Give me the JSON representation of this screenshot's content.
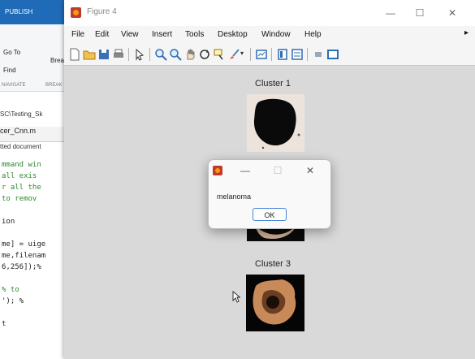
{
  "background_app": {
    "ribbon_tab": "PUBLISH",
    "toolbar": {
      "go_to": "Go To",
      "find": "Find",
      "breakpoints": "Brea",
      "navigate": "NAVIGATE",
      "edit": "BREAK"
    },
    "path": "SC\\Testing_Sk",
    "editor_tab": "cer_Cnn.m",
    "doc_notice": "tted document",
    "code_lines": [
      {
        "text": "mmand win",
        "color": "green"
      },
      {
        "text": " all exis",
        "color": "green"
      },
      {
        "text": "r all the",
        "color": "green"
      },
      {
        "text": " to remov",
        "color": "green"
      },
      {
        "text": "",
        "color": "black"
      },
      {
        "text": "ion",
        "color": "black"
      },
      {
        "text": "",
        "color": "black"
      },
      {
        "text": "me] = uige",
        "color": "black"
      },
      {
        "text": "me,filenam",
        "color": "black"
      },
      {
        "text": "6,256]);%",
        "color": "black"
      },
      {
        "text": "",
        "color": "black"
      },
      {
        "text": "    % to",
        "color": "green"
      },
      {
        "text": "');   %",
        "color": "black"
      },
      {
        "text": "",
        "color": "black"
      },
      {
        "text": "t",
        "color": "black"
      }
    ]
  },
  "figure_window": {
    "title": "Figure 4",
    "controls": {
      "minimize": "—",
      "maximize": "☐",
      "close": "✕"
    },
    "menu": [
      "File",
      "Edit",
      "View",
      "Insert",
      "Tools",
      "Desktop",
      "Window",
      "Help"
    ],
    "menu_more": "▸",
    "toolbar_icons": [
      "new-figure-icon",
      "open-file-icon",
      "save-icon",
      "print-icon",
      "pointer-icon",
      "zoom-in-icon",
      "zoom-out-icon",
      "pan-icon",
      "rotate-icon",
      "data-cursor-icon",
      "brush-icon",
      "link-icon",
      "colorbar-icon",
      "legend-icon",
      "hide-tools-icon",
      "dock-icon"
    ],
    "clusters": [
      {
        "label": "Cluster 1"
      },
      {
        "label": "Cluster 3"
      }
    ]
  },
  "dialog": {
    "message": "melanoma",
    "ok_label": "OK",
    "controls": {
      "minimize": "—",
      "maximize": "☐",
      "close": "✕"
    }
  },
  "colors": {
    "figure_bg": "#d9d9d9",
    "accent": "#4a86d8",
    "ribbon": "#1f6bb8"
  }
}
